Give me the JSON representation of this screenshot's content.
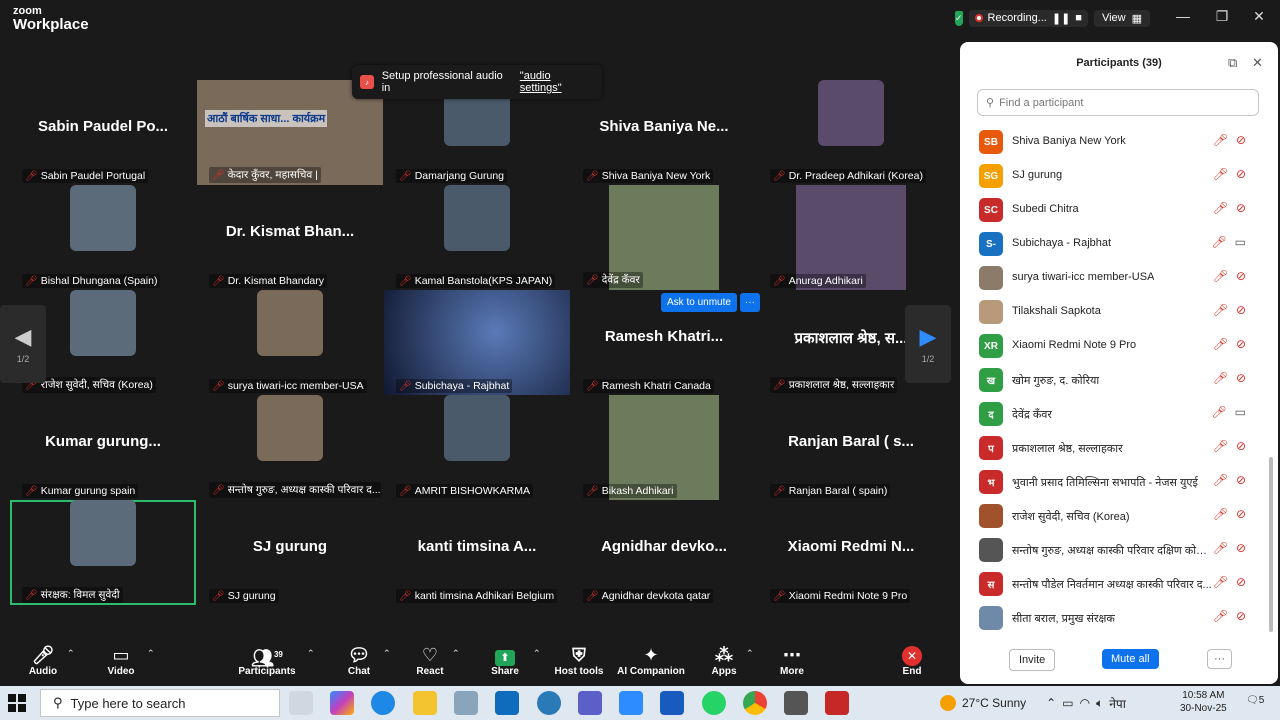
{
  "app": {
    "logo_line1": "zoom",
    "logo_line2": "Workplace"
  },
  "titlebar": {
    "recording_label": "Recording...",
    "view_label": "View",
    "minimize": "—",
    "restore": "❐",
    "close": "✕"
  },
  "toast": {
    "text": "Setup professional audio in",
    "link": "\"audio settings\""
  },
  "nav": {
    "page_left": "1/2",
    "page_right": "1/2"
  },
  "unmute": {
    "label": "Ask to unmute",
    "more": "···"
  },
  "tiles": [
    {
      "name": "Sabin Paudel Po...",
      "label": "Sabin Paudel Portugal",
      "video": false
    },
    {
      "name": "",
      "label": "केदार कुँवर, महासचिव |",
      "video": true,
      "banner": "आठौं बार्षिक साधा... कार्यक्रम"
    },
    {
      "name": "",
      "label": "Damarjang Gurung",
      "video": true
    },
    {
      "name": "Shiva Baniya Ne...",
      "label": "Shiva Baniya New York",
      "video": false
    },
    {
      "name": "",
      "label": "Dr. Pradeep Adhikari (Korea)",
      "video": true
    },
    {
      "name": "",
      "label": "Bishal Dhungana (Spain)",
      "video": true
    },
    {
      "name": "Dr. Kismat Bhan...",
      "label": "Dr. Kismat Bhandary",
      "video": false
    },
    {
      "name": "",
      "label": "Kamal Banstola(KPS JAPAN)",
      "video": true
    },
    {
      "name": "",
      "label": "देवेंद्र कँवर",
      "video": true
    },
    {
      "name": "",
      "label": "Anurag Adhikari",
      "video": true
    },
    {
      "name": "",
      "label": "राजेश सुवेदी, सचिव (Korea)",
      "video": true
    },
    {
      "name": "",
      "label": "surya tiwari-icc member-USA",
      "video": true
    },
    {
      "name": "",
      "label": "Subichaya - Rajbhat",
      "video": true
    },
    {
      "name": "Ramesh Khatri...",
      "label": "Ramesh Khatri Canada",
      "video": false
    },
    {
      "name": "प्रकाशलाल श्रेष्ठ, स...",
      "label": "प्रकाशलाल श्रेष्ठ, सल्लाहकार",
      "video": false
    },
    {
      "name": "Kumar gurung...",
      "label": "Kumar gurung  spain",
      "video": false
    },
    {
      "name": "",
      "label": "सन्तोष गुरुङ, अध्यक्ष कास्की परिवार द...",
      "video": true
    },
    {
      "name": "",
      "label": "AMRIT BISHOWKARMA",
      "video": true
    },
    {
      "name": "",
      "label": "Bikash Adhikari",
      "video": true
    },
    {
      "name": "Ranjan Baral ( s...",
      "label": "Ranjan Baral ( spain)",
      "video": false
    },
    {
      "name": "",
      "label": "संरक्षक: विमल सुवेदी",
      "video": true
    },
    {
      "name": "SJ gurung",
      "label": "SJ gurung",
      "video": false
    },
    {
      "name": "kanti timsina A...",
      "label": "kanti timsina Adhikari Belgium",
      "video": false
    },
    {
      "name": "Agnidhar devko...",
      "label": "Agnidhar devkota qatar",
      "video": false
    },
    {
      "name": "Xiaomi Redmi N...",
      "label": "Xiaomi Redmi Note 9 Pro",
      "video": false
    }
  ],
  "participants": {
    "title": "Participants (39)",
    "search_placeholder": "Find a participant",
    "list": [
      {
        "initials": "SB",
        "color": "#e8590c",
        "name": "Shiva Baniya New York",
        "cam": "off"
      },
      {
        "initials": "SG",
        "color": "#f59f00",
        "name": "SJ gurung",
        "cam": "off"
      },
      {
        "initials": "SC",
        "color": "#c92a2a",
        "name": "Subedi Chitra",
        "cam": "off"
      },
      {
        "initials": "S-",
        "color": "#1971c2",
        "name": "Subichaya - Rajbhat",
        "cam": "on"
      },
      {
        "initials": "",
        "color": "#8d7b6a",
        "name": "surya tiwari-icc member-USA",
        "cam": "off"
      },
      {
        "initials": "",
        "color": "#b89a7a",
        "name": "Tilakshali Sapkota",
        "cam": "off"
      },
      {
        "initials": "XR",
        "color": "#2f9e44",
        "name": "Xiaomi Redmi Note 9 Pro",
        "cam": "off"
      },
      {
        "initials": "ख",
        "color": "#2f9e44",
        "name": "खोम गुरुङ, द. कोरिया",
        "cam": "off"
      },
      {
        "initials": "द",
        "color": "#2f9e44",
        "name": "देवेंद्र कँवर",
        "cam": "on"
      },
      {
        "initials": "प",
        "color": "#c92a2a",
        "name": "प्रकाशलाल श्रेष्ठ, सल्लाहकार",
        "cam": "off"
      },
      {
        "initials": "भ",
        "color": "#c92a2a",
        "name": "भुवानी प्रसाद तिमिल्सिना सभापति - नेजस युएई",
        "cam": "off"
      },
      {
        "initials": "",
        "color": "#a0522d",
        "name": "राजेश सुवेदी, सचिव (Korea)",
        "cam": "off"
      },
      {
        "initials": "",
        "color": "#555555",
        "name": "सन्तोष गुरुङ, अध्यक्ष कास्की परिवार दक्षिण कोरि...",
        "cam": "off"
      },
      {
        "initials": "स",
        "color": "#c92a2a",
        "name": "सन्तोष पौडेल निवर्तमान अध्यक्ष कास्की परिवार द...",
        "cam": "off"
      },
      {
        "initials": "",
        "color": "#6e8aa8",
        "name": "सीता बराल, प्रमुख संरक्षक",
        "cam": "off"
      }
    ],
    "invite": "Invite",
    "mute_all": "Mute all",
    "more": "···"
  },
  "toolbar": {
    "audio": "Audio",
    "video": "Video",
    "participants": "Participants",
    "participants_count": "39",
    "chat": "Chat",
    "react": "React",
    "share": "Share",
    "host_tools": "Host tools",
    "ai": "AI Companion",
    "apps": "Apps",
    "more": "More",
    "end": "End"
  },
  "taskbar": {
    "search": "Type here to search",
    "weather": "27°C  Sunny",
    "lang": "नेपा",
    "time": "10:58 AM",
    "date": "30-Nov-25",
    "badge": "5"
  }
}
